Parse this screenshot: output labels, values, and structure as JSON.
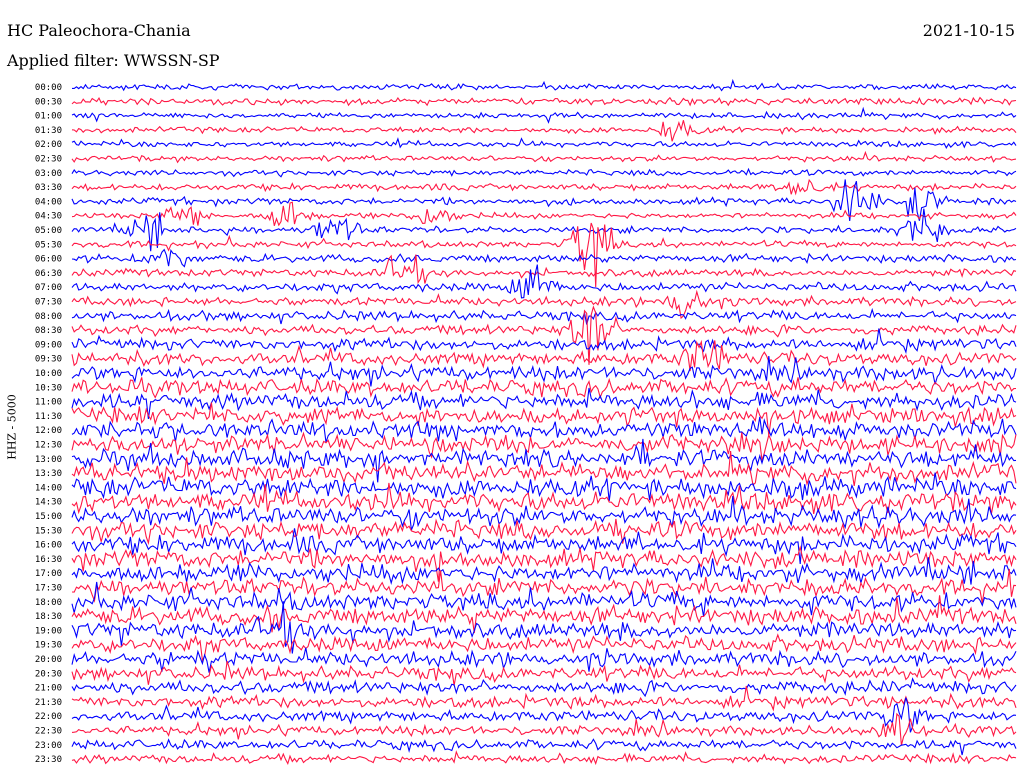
{
  "header": {
    "station": "HC Paleochora-Chania",
    "date": "2021-10-15",
    "filter": "Applied filter: WWSSN-SP"
  },
  "channel_label": "HHZ - 5000",
  "colors": {
    "even_row": "#0000ff",
    "odd_row": "#ff1744"
  },
  "chart_data": {
    "type": "line",
    "title": "HC Paleochora-Chania",
    "subtitle": "Applied filter: WWSSN-SP",
    "ylabel": "HHZ - 5000",
    "xlabel": "",
    "y_ticks": [
      "00:00",
      "00:30",
      "01:00",
      "01:30",
      "02:00",
      "02:30",
      "03:00",
      "03:30",
      "04:00",
      "04:30",
      "05:00",
      "05:30",
      "06:00",
      "06:30",
      "07:00",
      "07:30",
      "08:00",
      "08:30",
      "09:00",
      "09:30",
      "10:00",
      "10:30",
      "11:00",
      "11:30",
      "12:00",
      "12:30",
      "13:00",
      "13:30",
      "14:00",
      "14:30",
      "15:00",
      "15:30",
      "16:00",
      "16:30",
      "17:00",
      "17:30",
      "18:00",
      "18:30",
      "19:00",
      "19:30",
      "20:00",
      "20:30",
      "21:00",
      "21:30",
      "22:00",
      "22:30",
      "23:00",
      "23:30"
    ],
    "row_noise_level": [
      0.6,
      0.7,
      0.6,
      0.6,
      0.6,
      0.6,
      0.6,
      0.7,
      0.7,
      0.6,
      0.7,
      0.7,
      0.8,
      0.8,
      0.9,
      0.9,
      1.0,
      1.0,
      1.2,
      1.3,
      1.5,
      1.6,
      1.7,
      1.7,
      1.8,
      1.8,
      1.9,
      1.9,
      2.0,
      2.0,
      2.0,
      1.9,
      1.9,
      1.9,
      1.8,
      1.8,
      1.8,
      1.8,
      1.7,
      1.6,
      1.5,
      1.4,
      1.3,
      1.2,
      1.1,
      1.0,
      1.0,
      0.9
    ],
    "events": [
      {
        "row": 3,
        "x": 0.64,
        "amp": 1.2
      },
      {
        "row": 7,
        "x": 0.77,
        "amp": 1.8
      },
      {
        "row": 8,
        "x": 0.83,
        "amp": 3.2
      },
      {
        "row": 8,
        "x": 0.9,
        "amp": 2.0
      },
      {
        "row": 9,
        "x": 0.12,
        "amp": 2.0
      },
      {
        "row": 9,
        "x": 0.23,
        "amp": 1.8
      },
      {
        "row": 9,
        "x": 0.38,
        "amp": 1.5
      },
      {
        "row": 10,
        "x": 0.08,
        "amp": 1.5
      },
      {
        "row": 10,
        "x": 0.28,
        "amp": 1.8
      },
      {
        "row": 10,
        "x": 0.9,
        "amp": 2.5
      },
      {
        "row": 11,
        "x": 0.55,
        "amp": 4.5
      },
      {
        "row": 12,
        "x": 0.1,
        "amp": 1.5
      },
      {
        "row": 13,
        "x": 0.35,
        "amp": 1.8
      },
      {
        "row": 14,
        "x": 0.49,
        "amp": 2.5
      },
      {
        "row": 15,
        "x": 0.65,
        "amp": 2.2
      },
      {
        "row": 17,
        "x": 0.55,
        "amp": 4.0
      },
      {
        "row": 19,
        "x": 0.67,
        "amp": 2.0
      },
      {
        "row": 38,
        "x": 0.22,
        "amp": 1.5
      },
      {
        "row": 44,
        "x": 0.88,
        "amp": 1.8
      },
      {
        "row": 45,
        "x": 0.88,
        "amp": 1.6
      }
    ]
  }
}
